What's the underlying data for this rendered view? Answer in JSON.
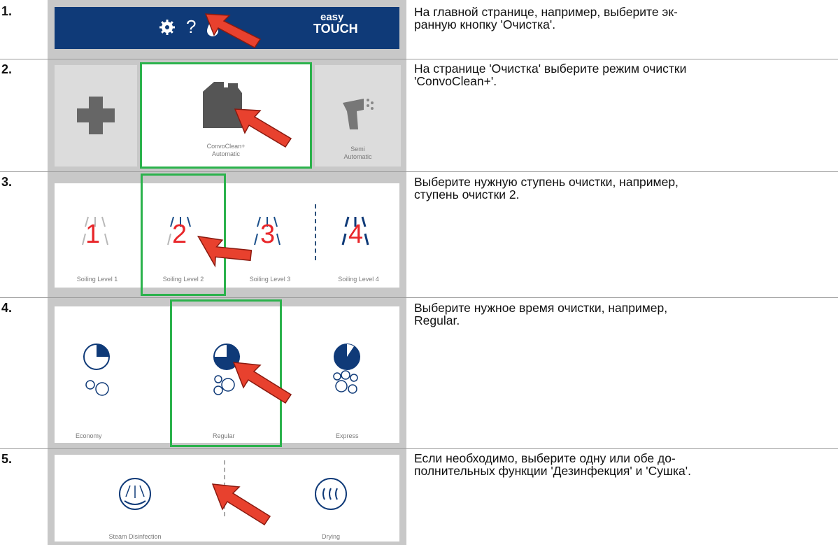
{
  "steps": [
    {
      "num": "1.",
      "text": "На главной странице, например, выберите эк-\nранную кнопку 'Очистка'."
    },
    {
      "num": "2.",
      "text": "На странице 'Очистка' выберите режим очистки\n'ConvoClean+'."
    },
    {
      "num": "3.",
      "text": "Выберите нужную ступень очистки, например,\nступень очистки 2."
    },
    {
      "num": "4.",
      "text": "Выберите нужное время очистки, например,\nRegular."
    },
    {
      "num": "5.",
      "text": "Если необходимо, выберите одну или обе до-\nполнительных функции 'Дезинфекция' и 'Сушка'."
    }
  ],
  "step1": {
    "help": "?",
    "brand_top": "easy",
    "brand_bottom": "TOUCH"
  },
  "step2": {
    "convo_line1": "ConvoClean+",
    "convo_line2": "Automatic",
    "semi_line1": "Semi",
    "semi_line2": "Automatic"
  },
  "step3": {
    "levels": [
      {
        "digit": "1",
        "label": "Soiling Level 1"
      },
      {
        "digit": "2",
        "label": "Soiling Level 2"
      },
      {
        "digit": "3",
        "label": "Soiling Level 3"
      },
      {
        "digit": "4",
        "label": "Soiling Level 4"
      }
    ]
  },
  "step4": {
    "modes": [
      {
        "label": "Economy"
      },
      {
        "label": "Regular"
      },
      {
        "label": "Express"
      }
    ]
  },
  "step5": {
    "disinfection": "Steam Disinfection",
    "drying": "Drying"
  },
  "colors": {
    "navy": "#0f3a78",
    "green": "#2bb24c",
    "arrow": "#e8412e",
    "digit": "#e8262a",
    "panel": "#c8c8c8"
  }
}
